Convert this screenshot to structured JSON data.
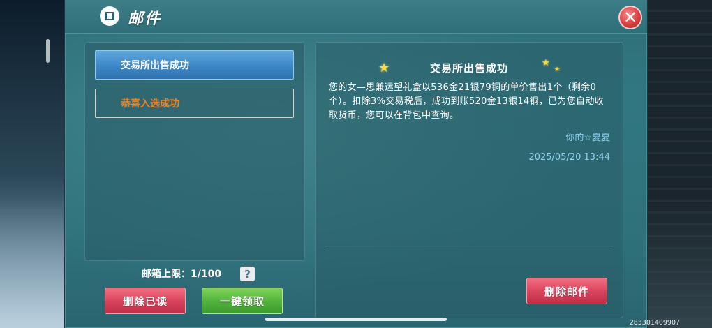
{
  "window": {
    "title": "邮件",
    "close_label": "✕"
  },
  "mail_list": {
    "items": [
      {
        "label": "交易所出售成功",
        "state": "selected"
      },
      {
        "label": "恭喜入选成功",
        "state": "unread"
      }
    ]
  },
  "footer": {
    "mailbox_limit": "邮箱上限：1/100",
    "help_label": "?",
    "delete_read_label": "删除已读",
    "claim_all_label": "一键领取"
  },
  "detail": {
    "title": "交易所出售成功",
    "body": "您的女—思兼远望礼盒以536金21银79铜的单价售出1个（剩余0个）。扣除3%交易税后，成功到账520金13银14铜，已为您自动收取货币，您可以在背包中查询。",
    "sender": "你的☆夏夏",
    "date": "2025/05/20 13:44",
    "delete_label": "删除邮件"
  },
  "build_id": "283301409907",
  "colors": {
    "accent_blue": "#3c87c6",
    "unread_orange": "#f0811f",
    "danger_red": "#d8425b",
    "confirm_green": "#50b23b",
    "meta_blue": "#8fd0ef"
  },
  "icons": {
    "title": "mail-icon",
    "close": "close-icon",
    "help": "help-icon",
    "decor": "star-icon"
  }
}
